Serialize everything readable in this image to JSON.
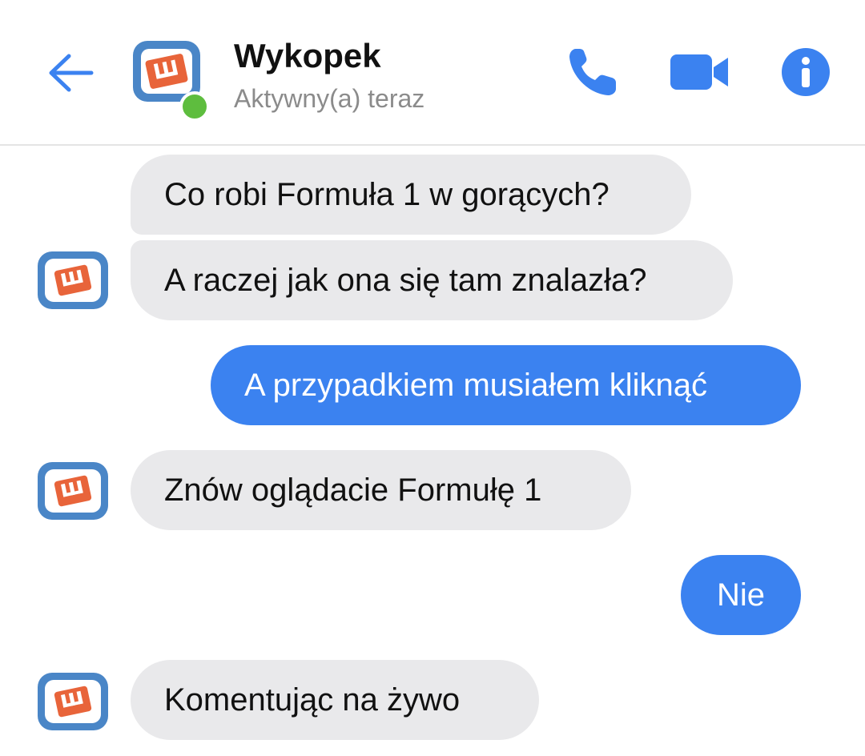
{
  "header": {
    "contact_name": "Wykopek",
    "status": "Aktywny(a) teraz",
    "back_icon": "arrow-left-icon",
    "call_icon": "phone-icon",
    "video_icon": "video-camera-icon",
    "info_icon": "info-icon",
    "accent_color": "#3b82f0",
    "online_color": "#5ebd3e"
  },
  "messages": [
    {
      "from": "contact",
      "text": "Co robi Formuła 1 w gorących?"
    },
    {
      "from": "contact",
      "text": "A raczej jak ona się tam znalazła?"
    },
    {
      "from": "me",
      "text": "A przypadkiem musiałem kliknąć"
    },
    {
      "from": "contact",
      "text": "Znów oglądacie Formułę 1"
    },
    {
      "from": "me",
      "text": "Nie"
    },
    {
      "from": "contact",
      "text": "Komentując na żywo"
    }
  ],
  "colors": {
    "incoming_bubble": "#e9e9eb",
    "outgoing_bubble": "#3b82f0",
    "logo_frame": "#4a86c7",
    "logo_fill": "#e8643a"
  }
}
